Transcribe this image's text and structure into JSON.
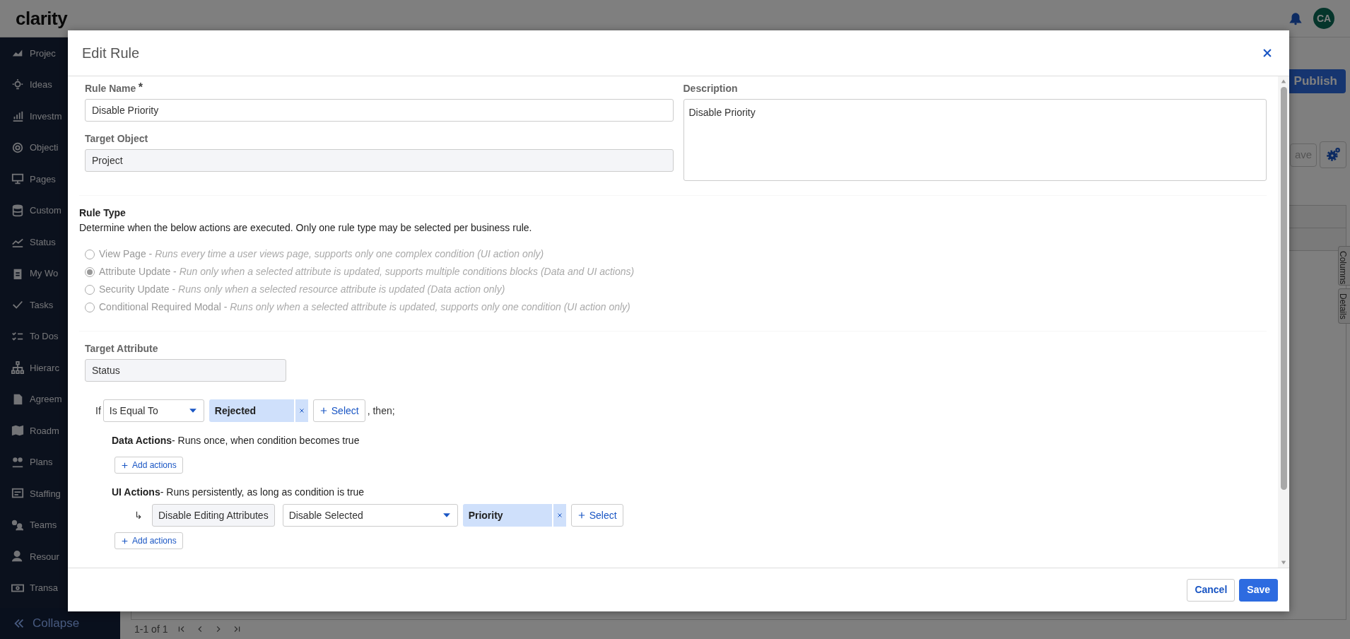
{
  "app": {
    "logo": "clarity",
    "avatar": "CA",
    "nav": [
      {
        "label": "Projec"
      },
      {
        "label": "Ideas"
      },
      {
        "label": "Investm"
      },
      {
        "label": "Objecti"
      },
      {
        "label": "Pages"
      },
      {
        "label": "Custom"
      },
      {
        "label": "Status"
      },
      {
        "label": "My Wo"
      },
      {
        "label": "Tasks"
      },
      {
        "label": "To Dos"
      },
      {
        "label": "Hierarc"
      },
      {
        "label": "Agreem"
      },
      {
        "label": "Roadm"
      },
      {
        "label": "Plans"
      },
      {
        "label": "Staffing"
      },
      {
        "label": "Teams"
      },
      {
        "label": "Resour"
      },
      {
        "label": "Transa"
      }
    ],
    "collapse": "Collapse",
    "publish": "Publish",
    "partial_button": "ave",
    "side_tabs": [
      "Columns",
      "Details"
    ],
    "pager": "1-1 of 1"
  },
  "modal": {
    "title": "Edit Rule",
    "rule_name": {
      "label": "Rule Name",
      "required_mark": "*",
      "value": "Disable Priority"
    },
    "target_object": {
      "label": "Target Object",
      "value": "Project"
    },
    "description": {
      "label": "Description",
      "value": "Disable Priority"
    },
    "rule_type": {
      "title": "Rule Type",
      "text": "Determine when the below actions are executed. Only one rule type may be selected per business rule.",
      "disabled": true,
      "options": [
        {
          "name": "View Page -",
          "detail": "Runs every time a user views page, supports only one complex condition (UI action only)",
          "selected": false
        },
        {
          "name": "Attribute Update -",
          "detail": "Run only when a selected attribute is updated, supports multiple conditions blocks (Data and UI actions)",
          "selected": true
        },
        {
          "name": "Security Update -",
          "detail": "Runs only when a selected resource attribute is updated (Data action only)",
          "selected": false
        },
        {
          "name": "Conditional Required Modal -",
          "detail": "Runs only when a selected attribute is updated, supports only one condition (UI action only)",
          "selected": false
        }
      ]
    },
    "target_attribute": {
      "label": "Target Attribute",
      "value": "Status"
    },
    "condition": {
      "if": "If",
      "operator": "Is Equal To",
      "values": [
        "Rejected"
      ],
      "select": "Select",
      "then": ", then;"
    },
    "data_actions": {
      "title": "Data Actions",
      "text": "- Runs once, when condition becomes true",
      "add": "Add actions"
    },
    "ui_actions": {
      "title": "UI Actions",
      "text": "- Runs persistently, as long as condition is true",
      "rows": [
        {
          "arrow": "↳",
          "action": "Disable Editing Attributes",
          "mode": "Disable Selected",
          "values": [
            "Priority"
          ],
          "select": "Select"
        }
      ],
      "add": "Add actions"
    },
    "buttons": [
      {
        "label": "Cancel",
        "kind": "secondary"
      },
      {
        "label": "Save",
        "kind": "primary"
      }
    ]
  }
}
